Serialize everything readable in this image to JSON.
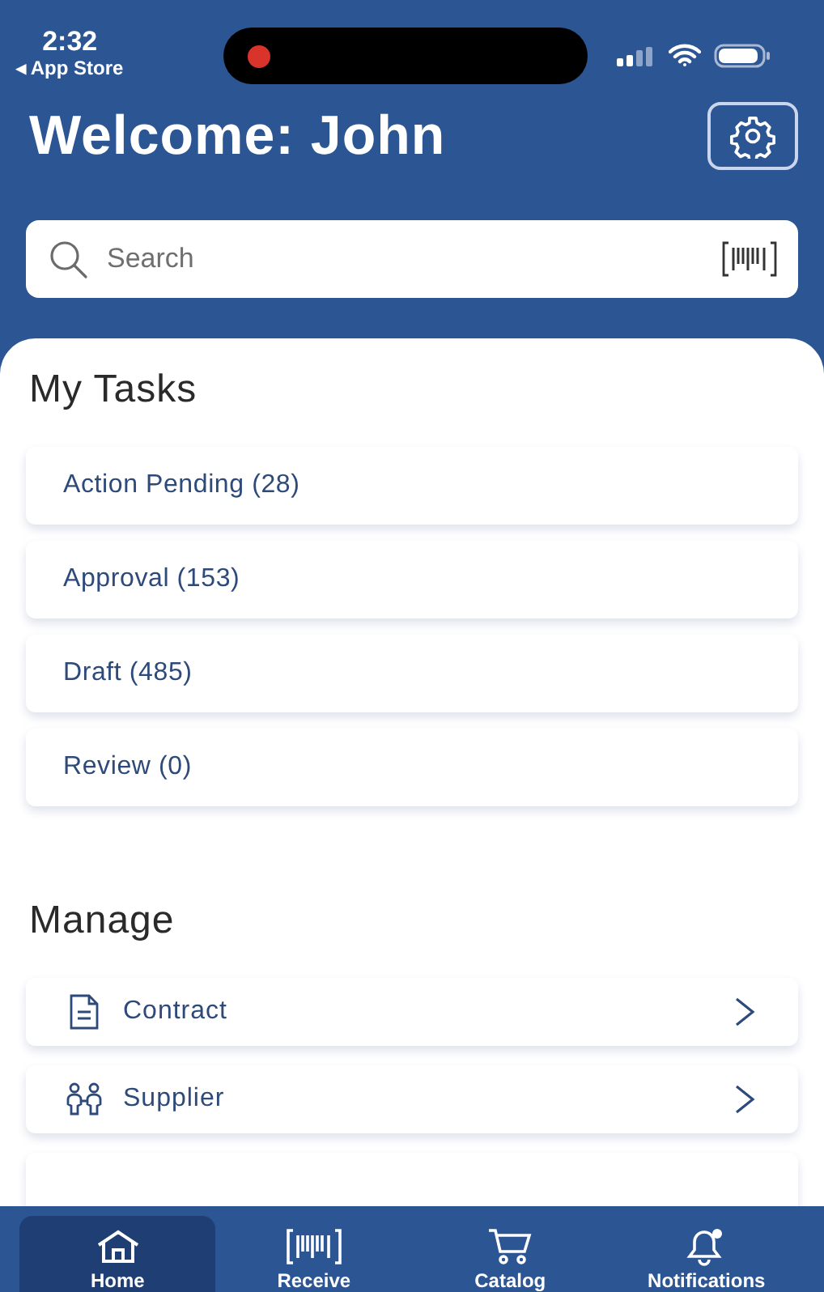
{
  "status_bar": {
    "time": "2:32",
    "back_link": "◂ App Store"
  },
  "header": {
    "title": "Welcome: John"
  },
  "search": {
    "placeholder": "Search"
  },
  "my_tasks": {
    "title": "My Tasks",
    "items": [
      {
        "label": "Action Pending (28)"
      },
      {
        "label": "Approval (153)"
      },
      {
        "label": "Draft (485)"
      },
      {
        "label": "Review (0)"
      }
    ]
  },
  "manage": {
    "title": "Manage",
    "items": [
      {
        "label": "Contract",
        "kind": "document"
      },
      {
        "label": "Supplier",
        "kind": "people"
      }
    ]
  },
  "tab_bar": [
    {
      "label": "Home",
      "kind": "home",
      "selected": true
    },
    {
      "label": "Receive",
      "kind": "barcode",
      "selected": false
    },
    {
      "label": "Catalog",
      "kind": "cart",
      "selected": false
    },
    {
      "label": "Notifications",
      "kind": "bell",
      "selected": false
    }
  ]
}
